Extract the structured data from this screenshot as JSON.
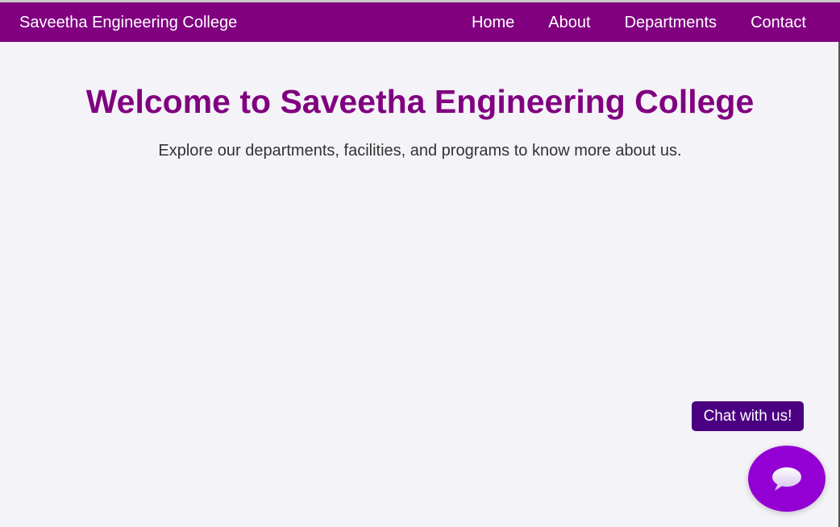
{
  "navbar": {
    "brand": "Saveetha Engineering College",
    "links": [
      "Home",
      "About",
      "Departments",
      "Contact"
    ]
  },
  "hero": {
    "title": "Welcome to Saveetha Engineering College",
    "subtitle": "Explore our departments, facilities, and programs to know more about us."
  },
  "chat": {
    "tooltip": "Chat with us!",
    "icon": "chat-bubble-icon"
  },
  "colors": {
    "navbar": "#800080",
    "title": "#800080",
    "tooltip": "#4b0082",
    "chat_button": "#9400d3",
    "background": "#f4f3f8"
  }
}
